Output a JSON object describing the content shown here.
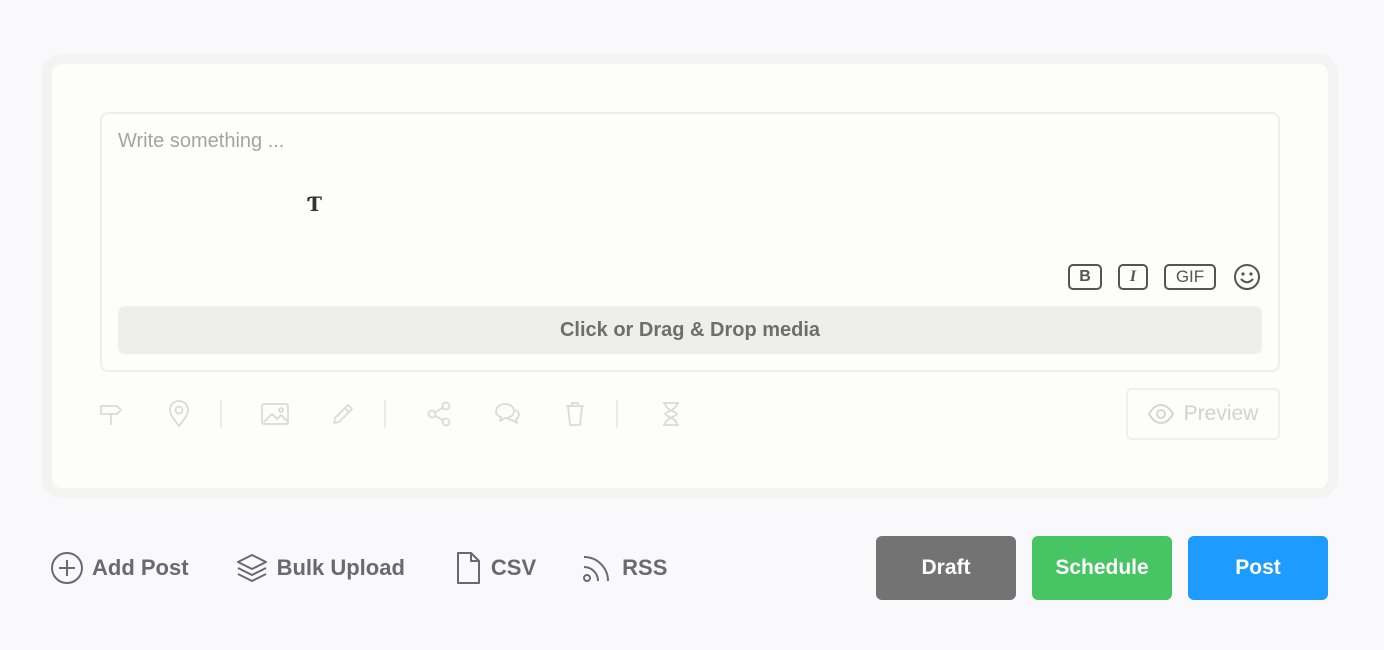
{
  "editor": {
    "placeholder": "Write something ...",
    "cursor_glyph": "Ƭ",
    "format": {
      "bold_label": "B",
      "italic_label": "I",
      "gif_label": "GIF"
    },
    "dropzone_label": "Click or Drag & Drop media"
  },
  "toolbar": {
    "icons": [
      "signpost-icon",
      "location-pin-icon",
      "image-icon",
      "pencil-icon",
      "share-icon",
      "comments-icon",
      "trash-icon",
      "hourglass-icon"
    ],
    "preview_label": "Preview"
  },
  "bottom": {
    "add_post_label": "Add Post",
    "bulk_upload_label": "Bulk Upload",
    "csv_label": "CSV",
    "rss_label": "RSS"
  },
  "actions": {
    "draft_label": "Draft",
    "schedule_label": "Schedule",
    "post_label": "Post"
  },
  "colors": {
    "draft": "#737373",
    "schedule": "#47c463",
    "post": "#1e9bff"
  }
}
